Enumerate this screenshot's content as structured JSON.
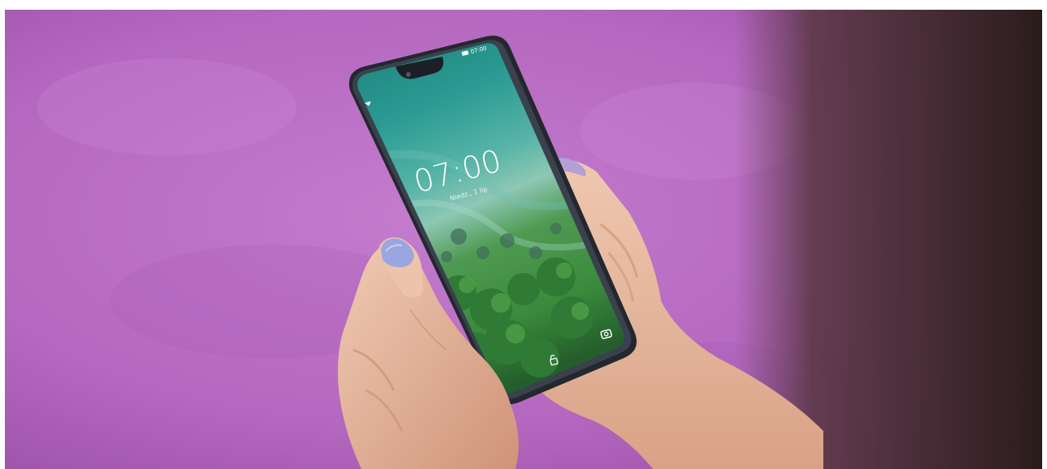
{
  "scene": {
    "description_colors": {
      "background": "#b86ac2",
      "background_dark": "#9a4fa6",
      "shadow_right": "#3a2624",
      "skin": "#e9bfa6",
      "skin_shade": "#c98f74",
      "nail": "#9aa6e0",
      "phone_frame": "#2a2f3a"
    }
  },
  "lockscreen": {
    "time": "07:00",
    "date": "Niedz., 1 lip",
    "status_time": "07:00",
    "wallpaper_colors": {
      "sea_top": "#1f8a7e",
      "sea_mid": "#3aa8a0",
      "beach": "#9fc9b8",
      "forest": "#3c8a3c",
      "forest_dark": "#245e2c"
    },
    "icons": {
      "wifi": "wifi-icon",
      "battery": "battery-icon",
      "camera": "camera-icon",
      "lock": "lock-icon"
    }
  }
}
